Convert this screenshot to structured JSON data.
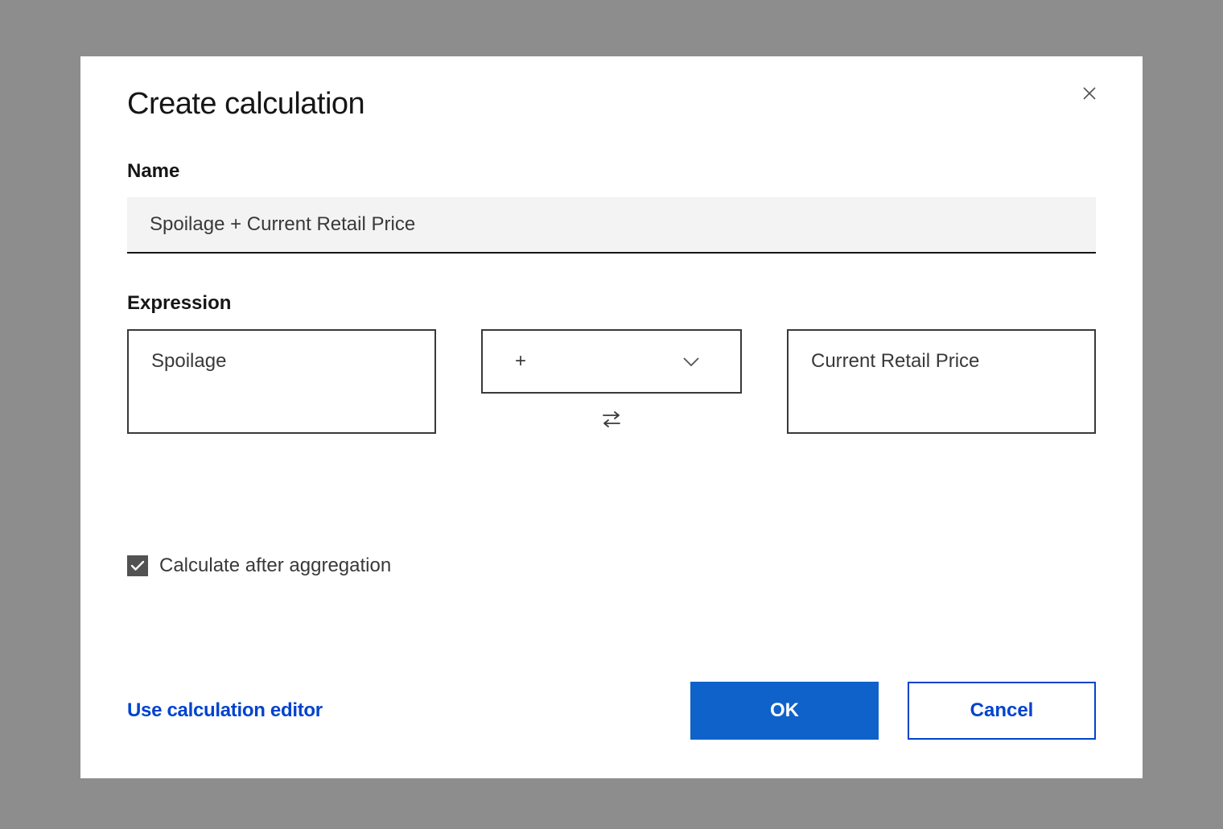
{
  "dialog": {
    "title": "Create calculation",
    "name_label": "Name",
    "name_value": "Spoilage + Current Retail Price",
    "expression_label": "Expression",
    "operand_left": "Spoilage",
    "operator": "+",
    "operand_right": "Current Retail Price",
    "checkbox_label": "Calculate after aggregation",
    "checkbox_checked": true,
    "editor_link": "Use calculation editor",
    "ok_label": "OK",
    "cancel_label": "Cancel"
  }
}
